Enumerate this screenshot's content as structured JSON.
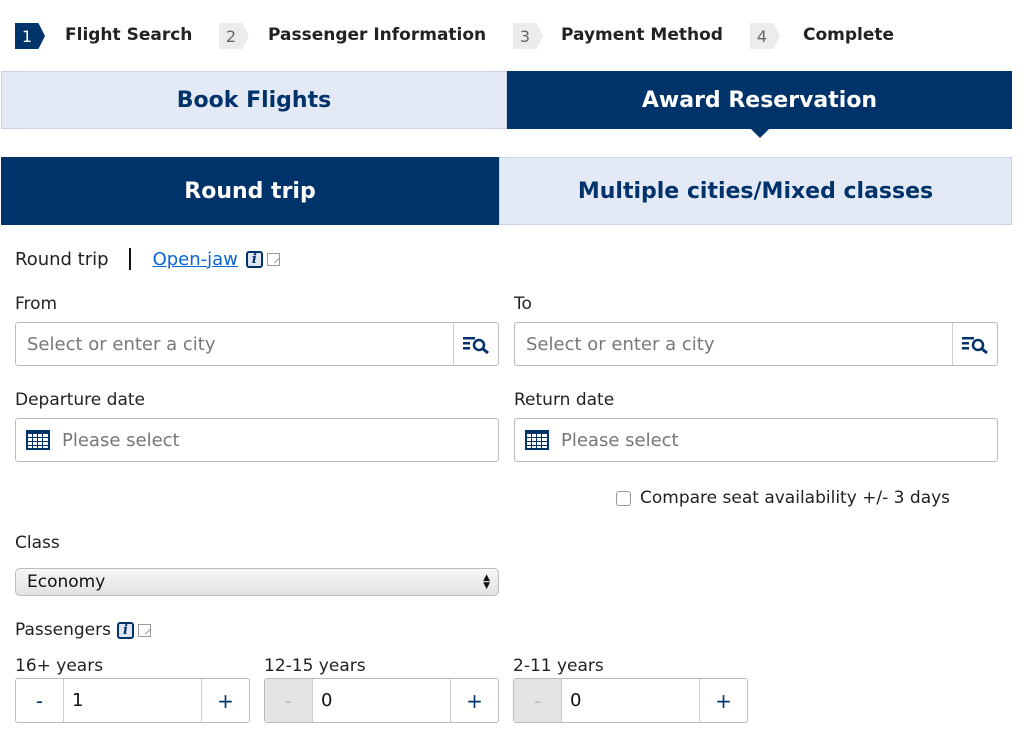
{
  "steps": [
    {
      "num": "1",
      "label": "Flight Search",
      "active": true
    },
    {
      "num": "2",
      "label": "Passenger Information"
    },
    {
      "num": "3",
      "label": "Payment Method"
    },
    {
      "num": "4",
      "label": "Complete"
    }
  ],
  "main_tabs": {
    "book": "Book Flights",
    "award": "Award Reservation",
    "selected": "Award Reservation"
  },
  "trip_tabs": {
    "round": "Round trip",
    "multi": "Multiple cities/Mixed classes",
    "selected": "Round trip"
  },
  "trip_type": {
    "current": "Round trip",
    "link": "Open-jaw"
  },
  "from": {
    "label": "From",
    "placeholder": "Select or enter a city"
  },
  "to": {
    "label": "To",
    "placeholder": "Select or enter a city"
  },
  "departure": {
    "label": "Departure date",
    "placeholder": "Please select"
  },
  "return": {
    "label": "Return date",
    "placeholder": "Please select"
  },
  "compare": {
    "label": "Compare seat availability +/- 3 days",
    "checked": false
  },
  "class": {
    "label": "Class",
    "value": "Economy"
  },
  "passengers": {
    "label": "Passengers",
    "groups": [
      {
        "label": "16+ years",
        "value": "1",
        "minus": "-",
        "plus": "+"
      },
      {
        "label": "12-15 years",
        "value": "0",
        "minus": "-",
        "plus": "+"
      },
      {
        "label": "2-11 years",
        "value": "0",
        "minus": "-",
        "plus": "+"
      }
    ]
  },
  "colors": {
    "navy": "#00336a",
    "light_tab": "#e3e9f5",
    "link": "#0a66d6"
  }
}
